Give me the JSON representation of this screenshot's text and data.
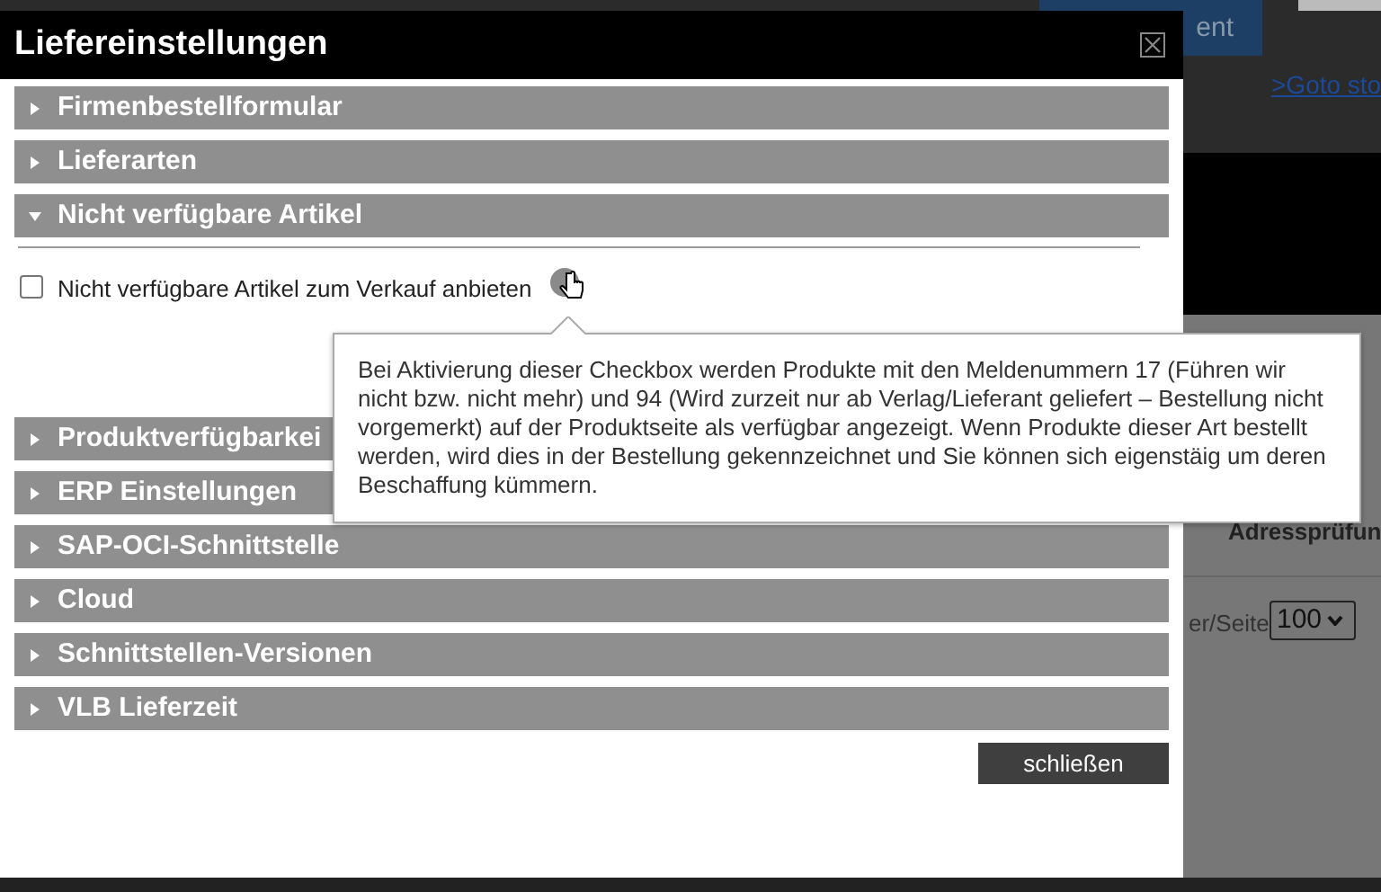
{
  "background": {
    "button_text": "ent",
    "link": ">Goto sto",
    "column_header": "Adressprüfun",
    "per_page_label": "er/Seite",
    "per_page_value": "100"
  },
  "dialog": {
    "title": "Liefereinstellungen",
    "sections": [
      {
        "title": "Firmenbestellformular",
        "expanded": false
      },
      {
        "title": "Lieferarten",
        "expanded": false
      },
      {
        "title": "Nicht verfügbare Artikel",
        "expanded": true,
        "option": {
          "label": "Nicht verfügbare Artikel zum Verkauf anbieten",
          "checked": false
        }
      },
      {
        "title": "Produktverfügbarkei",
        "expanded": false
      },
      {
        "title": "ERP Einstellungen",
        "expanded": false
      },
      {
        "title": "SAP-OCI-Schnittstelle",
        "expanded": false
      },
      {
        "title": "Cloud",
        "expanded": false
      },
      {
        "title": "Schnittstellen-Versionen",
        "expanded": false
      },
      {
        "title": "VLB Lieferzeit",
        "expanded": false
      }
    ],
    "close_button": "schließen"
  },
  "tooltip": {
    "text": "Bei Aktivierung dieser Checkbox werden Produkte mit den Meldenummern 17 (Führen wir nicht bzw. nicht mehr) und 94 (Wird zurzeit nur ab Verlag/Lieferant geliefert – Bestellung nicht vorgemerkt) auf der Produktseite als verfügbar angezeigt. Wenn Produkte dieser Art bestellt werden, wird dies in der Bestellung gekennzeichnet und Sie können sich eigenstäig um deren Beschaffung kümmern."
  }
}
